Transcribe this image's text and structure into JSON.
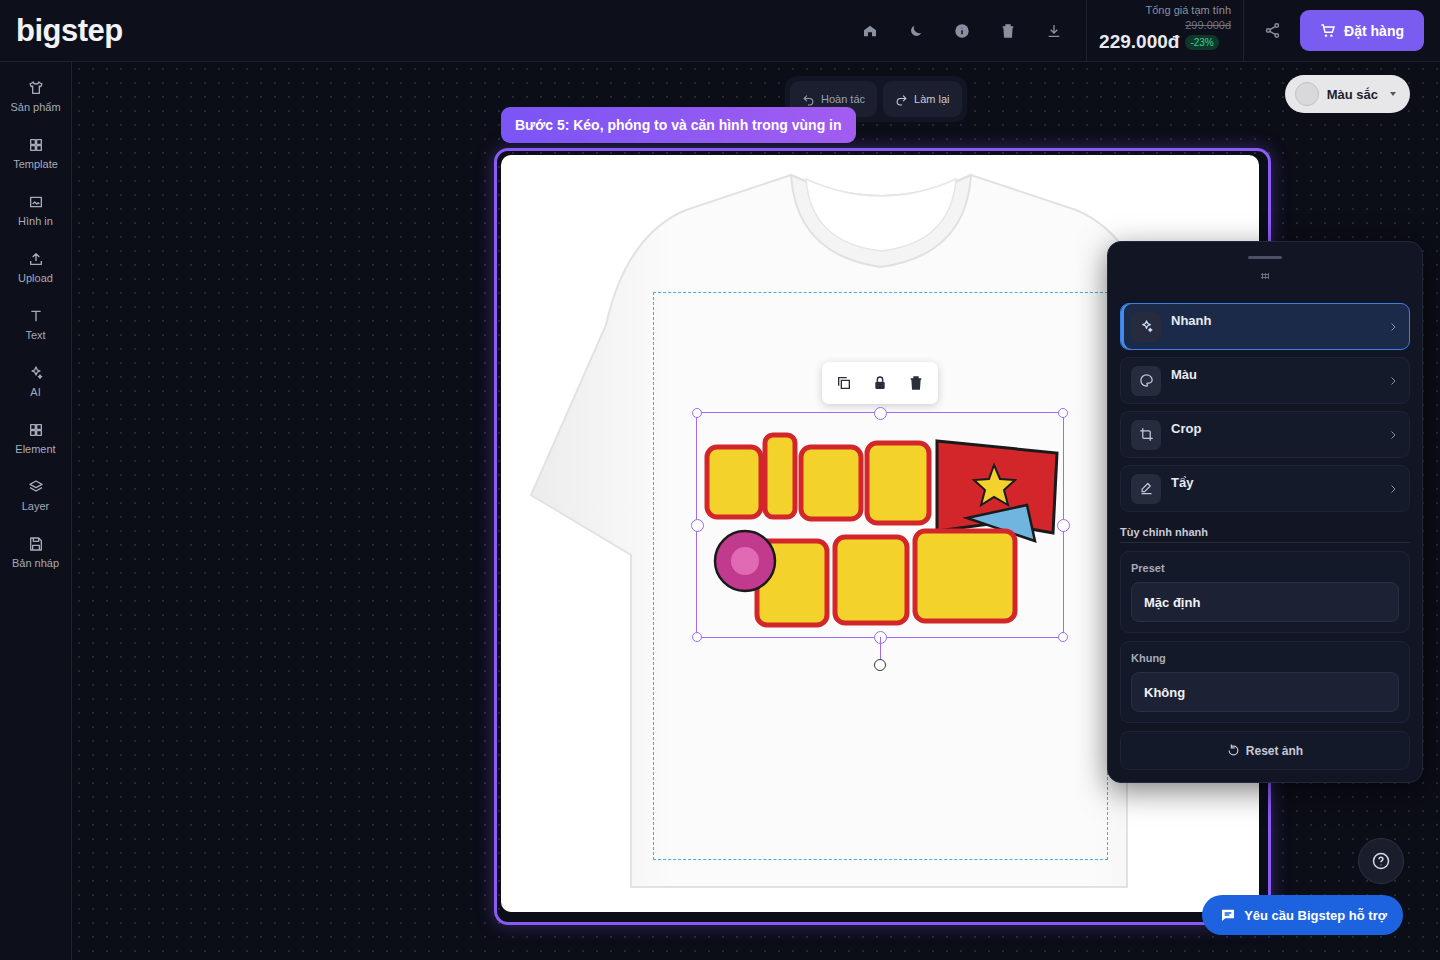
{
  "logo": "bigstep",
  "price": {
    "label": "Tổng giá tạm tính",
    "original": "299.000đ",
    "current": "229.000đ",
    "discount": "-23%"
  },
  "order_button": "Đặt hàng",
  "sidebar": {
    "items": [
      {
        "label": "Sản phẩm",
        "selected": false
      },
      {
        "label": "Template",
        "selected": false
      },
      {
        "label": "Hình in",
        "selected": false
      },
      {
        "label": "Upload",
        "selected": false
      },
      {
        "label": "Text",
        "selected": false
      },
      {
        "label": "AI",
        "selected": false
      },
      {
        "label": "Element",
        "selected": false
      },
      {
        "label": "Layer",
        "selected": false
      },
      {
        "label": "Bản nháp",
        "selected": false
      }
    ]
  },
  "history": {
    "undo": "Hoàn tác",
    "redo": "Làm lại"
  },
  "color_picker": {
    "label": "Màu sắc"
  },
  "step_hint": "Bước 5: Kéo, phóng to và căn hình trong vùng in",
  "design": {
    "selected": true
  },
  "edit_panel": {
    "tools": [
      {
        "label": "Nhanh",
        "selected": true
      },
      {
        "label": "Màu",
        "selected": false
      },
      {
        "label": "Crop",
        "selected": false
      },
      {
        "label": "Tẩy",
        "selected": false
      }
    ],
    "section_title": "Tùy chỉnh nhanh",
    "fields": [
      {
        "label": "Preset",
        "value": "Mặc định"
      },
      {
        "label": "Khung",
        "value": "Không"
      }
    ],
    "reset": "Reset ảnh"
  },
  "support_button": "Yêu cầu Bigstep hỗ trợ"
}
